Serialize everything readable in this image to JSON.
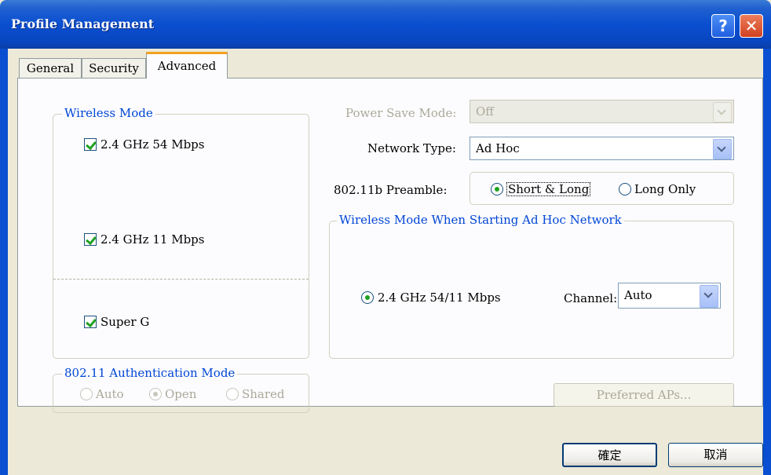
{
  "window": {
    "title": "Profile Management",
    "help_glyph": "?",
    "close_glyph": "✕"
  },
  "tabs": [
    {
      "label": "General"
    },
    {
      "label": "Security"
    },
    {
      "label": "Advanced"
    }
  ],
  "wireless_mode": {
    "title": "Wireless Mode",
    "options": [
      {
        "label": "2.4 GHz 54 Mbps",
        "checked": true
      },
      {
        "label": "2.4 GHz 11 Mbps",
        "checked": true
      },
      {
        "label": "Super G",
        "checked": true
      }
    ]
  },
  "auth_mode": {
    "title": "802.11 Authentication Mode",
    "options": [
      {
        "label": "Auto",
        "selected": false
      },
      {
        "label": "Open",
        "selected": true
      },
      {
        "label": "Shared",
        "selected": false
      }
    ]
  },
  "power_save": {
    "label": "Power Save Mode:",
    "value": "Off",
    "enabled": false
  },
  "network_type": {
    "label": "Network Type:",
    "value": "Ad Hoc"
  },
  "preamble": {
    "label": "802.11b Preamble:",
    "options": [
      {
        "label": "Short & Long",
        "selected": true
      },
      {
        "label": "Long Only",
        "selected": false
      }
    ]
  },
  "adhoc": {
    "title": "Wireless Mode When Starting Ad Hoc Network",
    "mode_label": "2.4 GHz 54/11 Mbps",
    "channel_label": "Channel:",
    "channel_value": "Auto"
  },
  "preferred_aps_label": "Preferred APs...",
  "footer": {
    "ok_label": "確定",
    "cancel_label": "取消"
  },
  "colors": {
    "titlebar": "#0a4fd1",
    "group_title": "#0046d5",
    "tab_accent": "#f3a11e",
    "check": "#21a121"
  }
}
